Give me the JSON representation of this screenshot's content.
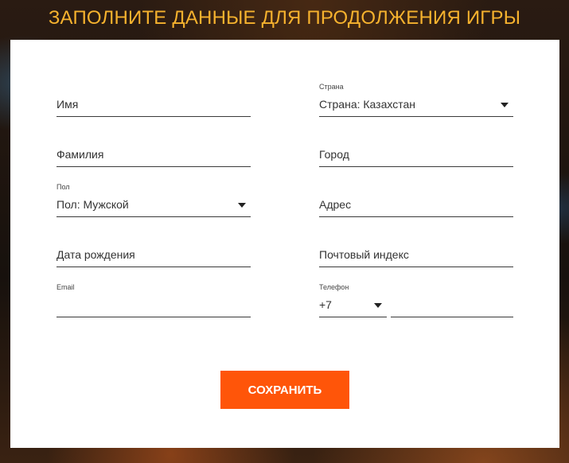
{
  "page_title": "ЗАПОЛНИТЕ ДАННЫЕ ДЛЯ ПРОДОЛЖЕНИЯ ИГРЫ",
  "colors": {
    "title": "#f6b22e",
    "button_bg": "#ff5509",
    "card_bg": "#ffffff"
  },
  "form": {
    "first_name": {
      "placeholder": "Имя"
    },
    "last_name": {
      "placeholder": "Фамилия"
    },
    "gender": {
      "label": "Пол",
      "selected": "Пол: Мужской"
    },
    "birth_date": {
      "placeholder": "Дата рождения"
    },
    "email": {
      "label": "Email",
      "value": ""
    },
    "country": {
      "label": "Страна",
      "selected": "Страна: Казахстан"
    },
    "city": {
      "placeholder": "Город"
    },
    "address": {
      "placeholder": "Адрес"
    },
    "postal_code": {
      "placeholder": "Почтовый индекс"
    },
    "phone": {
      "label": "Телефон",
      "code": "+7",
      "number": ""
    }
  },
  "buttons": {
    "save": "СОХРАНИТЬ"
  }
}
